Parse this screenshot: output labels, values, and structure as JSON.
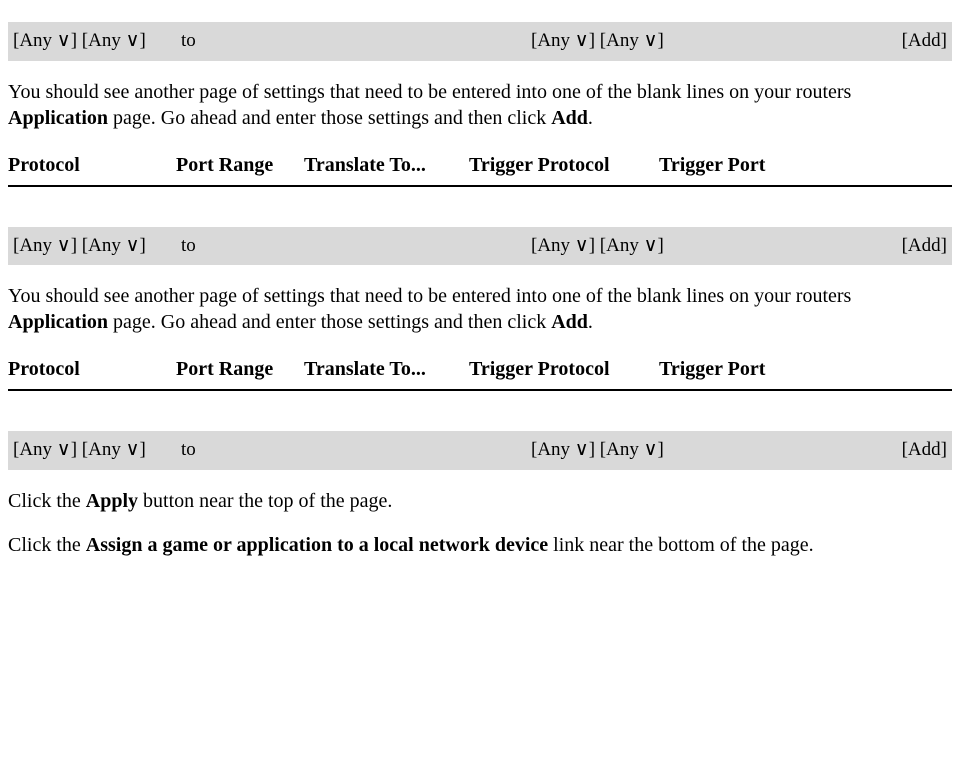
{
  "row1": {
    "protocol": "[Any ∨] [Any ∨]",
    "to": "to",
    "trigger_proto": "[Any ∨] [Any ∨]",
    "add": "[Add]"
  },
  "para1": {
    "text_before": "You should see another page of settings that need to be entered into one of the blank lines on your routers ",
    "bold1": "Application",
    "text_mid1": " page. Go ahead and enter those settings and then click ",
    "bold2": "Add",
    "text_after1": "."
  },
  "headers": {
    "protocol": "Protocol",
    "portrange": "Port Range",
    "translate": "Translate To...",
    "triggerproto": "Trigger Protocol",
    "triggerport": "Trigger Port"
  },
  "row2": {
    "protocol": "[Any ∨] [Any ∨]",
    "to": "to",
    "trigger_proto": "[Any ∨] [Any ∨]",
    "add": "[Add]"
  },
  "para2": {
    "text_before": "You should see another page of settings that need to be entered into one of the blank lines on your routers ",
    "bold1": "Application",
    "text_mid1": " page. Go ahead and enter those settings and then click ",
    "bold2": "Add",
    "text_after1": "."
  },
  "row3": {
    "protocol": "[Any ∨] [Any ∨]",
    "to": "to",
    "trigger_proto": "[Any ∨] [Any ∨]",
    "add": "[Add]"
  },
  "para3": {
    "text1": "Click the ",
    "bold1": "Apply",
    "text2": " button near the top of the page."
  },
  "para4": {
    "text1": "Click the ",
    "bold1": "Assign a game or application to a local network device",
    "text2": " link near the bottom of the page."
  }
}
